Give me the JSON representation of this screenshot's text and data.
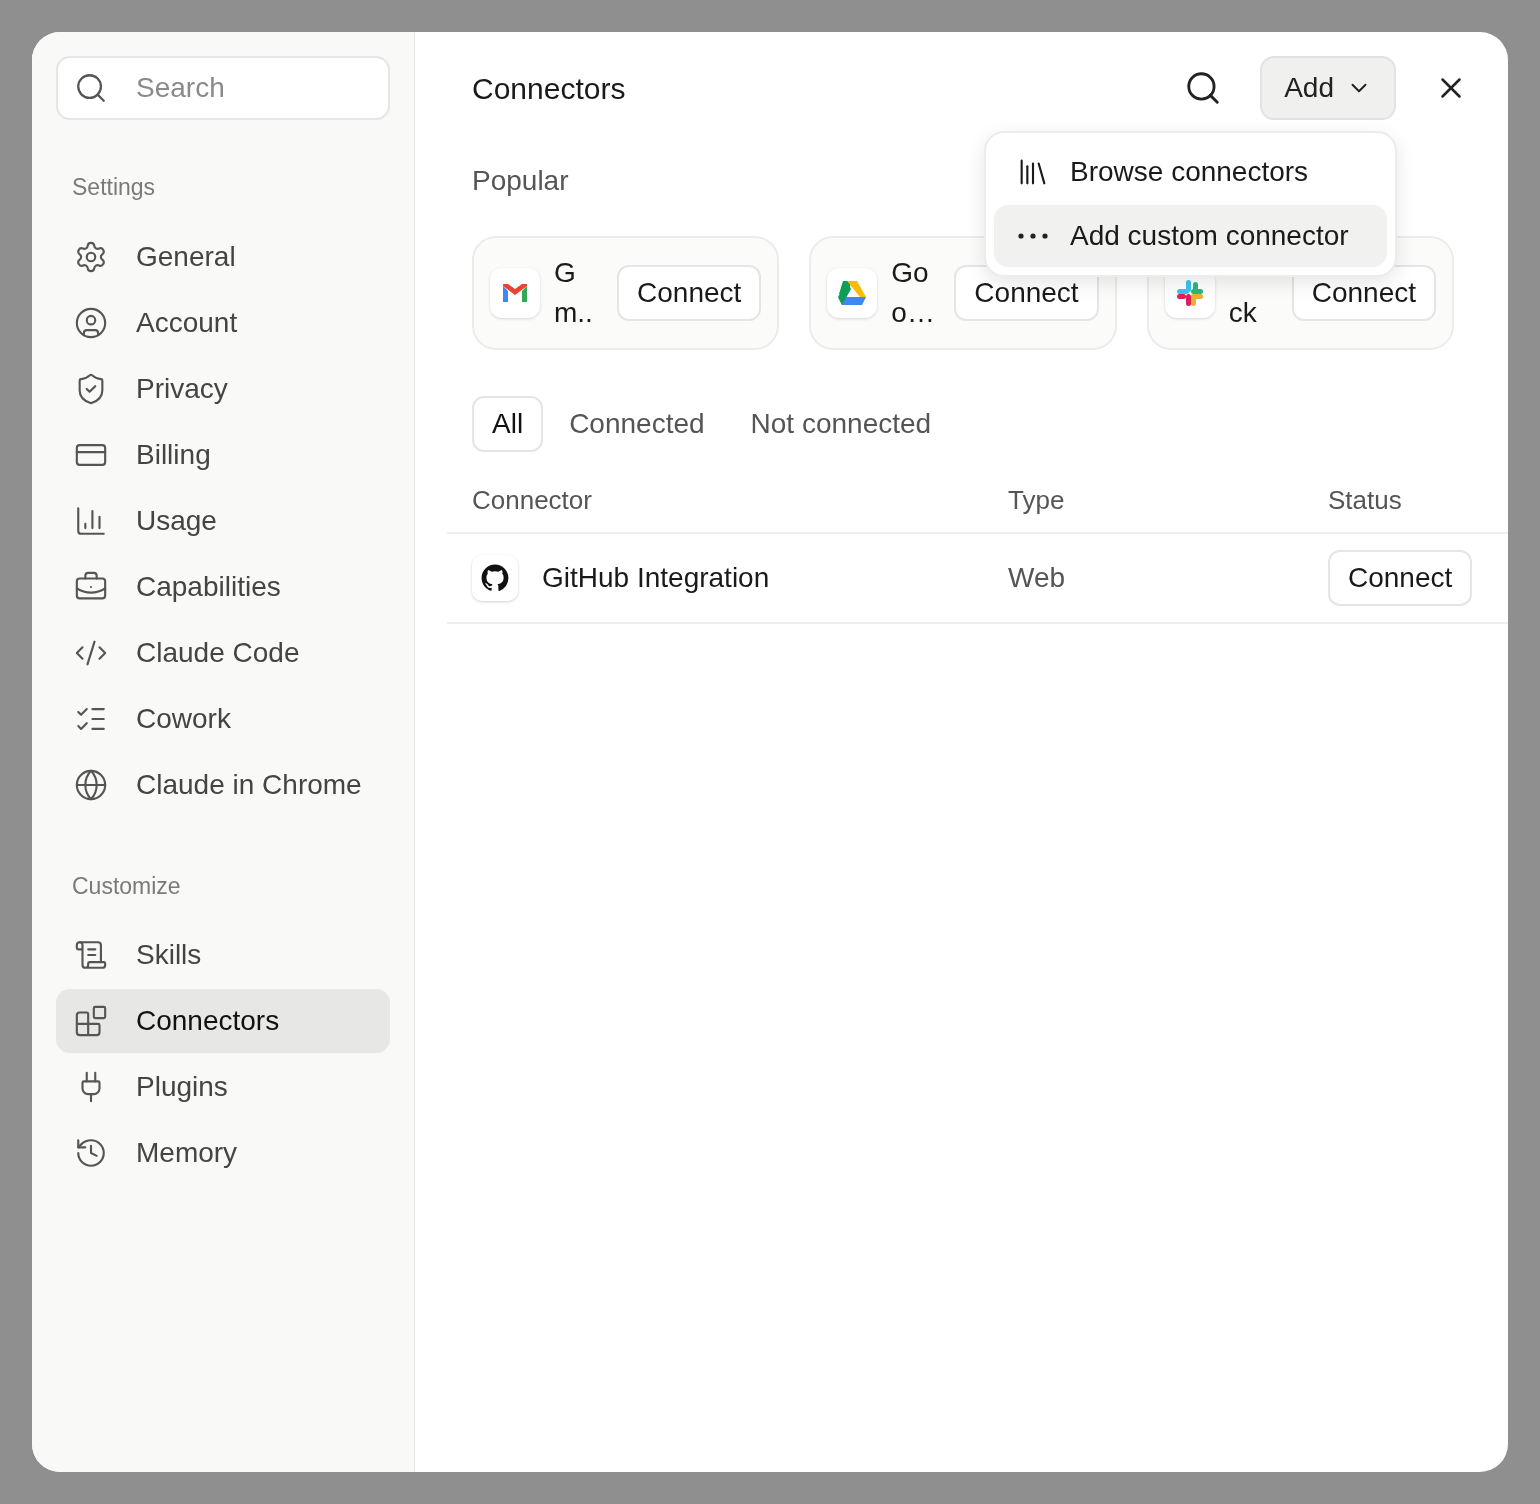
{
  "search": {
    "placeholder": "Search"
  },
  "sidebar": {
    "sections": [
      {
        "heading": "Settings",
        "items": [
          {
            "label": "General",
            "selected": false
          },
          {
            "label": "Account",
            "selected": false
          },
          {
            "label": "Privacy",
            "selected": false
          },
          {
            "label": "Billing",
            "selected": false
          },
          {
            "label": "Usage",
            "selected": false
          },
          {
            "label": "Capabilities",
            "selected": false
          },
          {
            "label": "Claude Code",
            "selected": false
          },
          {
            "label": "Cowork",
            "selected": false
          },
          {
            "label": "Claude in Chrome",
            "selected": false
          }
        ]
      },
      {
        "heading": "Customize",
        "items": [
          {
            "label": "Skills",
            "selected": false
          },
          {
            "label": "Connectors",
            "selected": true
          },
          {
            "label": "Plugins",
            "selected": false
          },
          {
            "label": "Memory",
            "selected": false
          }
        ]
      }
    ]
  },
  "header": {
    "title": "Connectors",
    "add_button": "Add"
  },
  "add_menu": {
    "items": [
      {
        "label": "Browse connectors",
        "selected": false
      },
      {
        "label": "Add custom connector",
        "selected": true
      }
    ]
  },
  "popular": {
    "heading": "Popular",
    "cards": [
      {
        "name_lines": [
          "G",
          "m.."
        ],
        "button": "Connect"
      },
      {
        "name_lines": [
          "Go",
          "o…"
        ],
        "button": "Connect"
      },
      {
        "name_lines": [
          "ck"
        ],
        "button": "Connect"
      }
    ]
  },
  "filter_tabs": [
    {
      "label": "All",
      "selected": true
    },
    {
      "label": "Connected",
      "selected": false
    },
    {
      "label": "Not connected",
      "selected": false
    }
  ],
  "table": {
    "columns": [
      "Connector",
      "Type",
      "Status"
    ],
    "rows": [
      {
        "name": "GitHub Integration",
        "type": "Web",
        "action": "Connect"
      }
    ]
  }
}
